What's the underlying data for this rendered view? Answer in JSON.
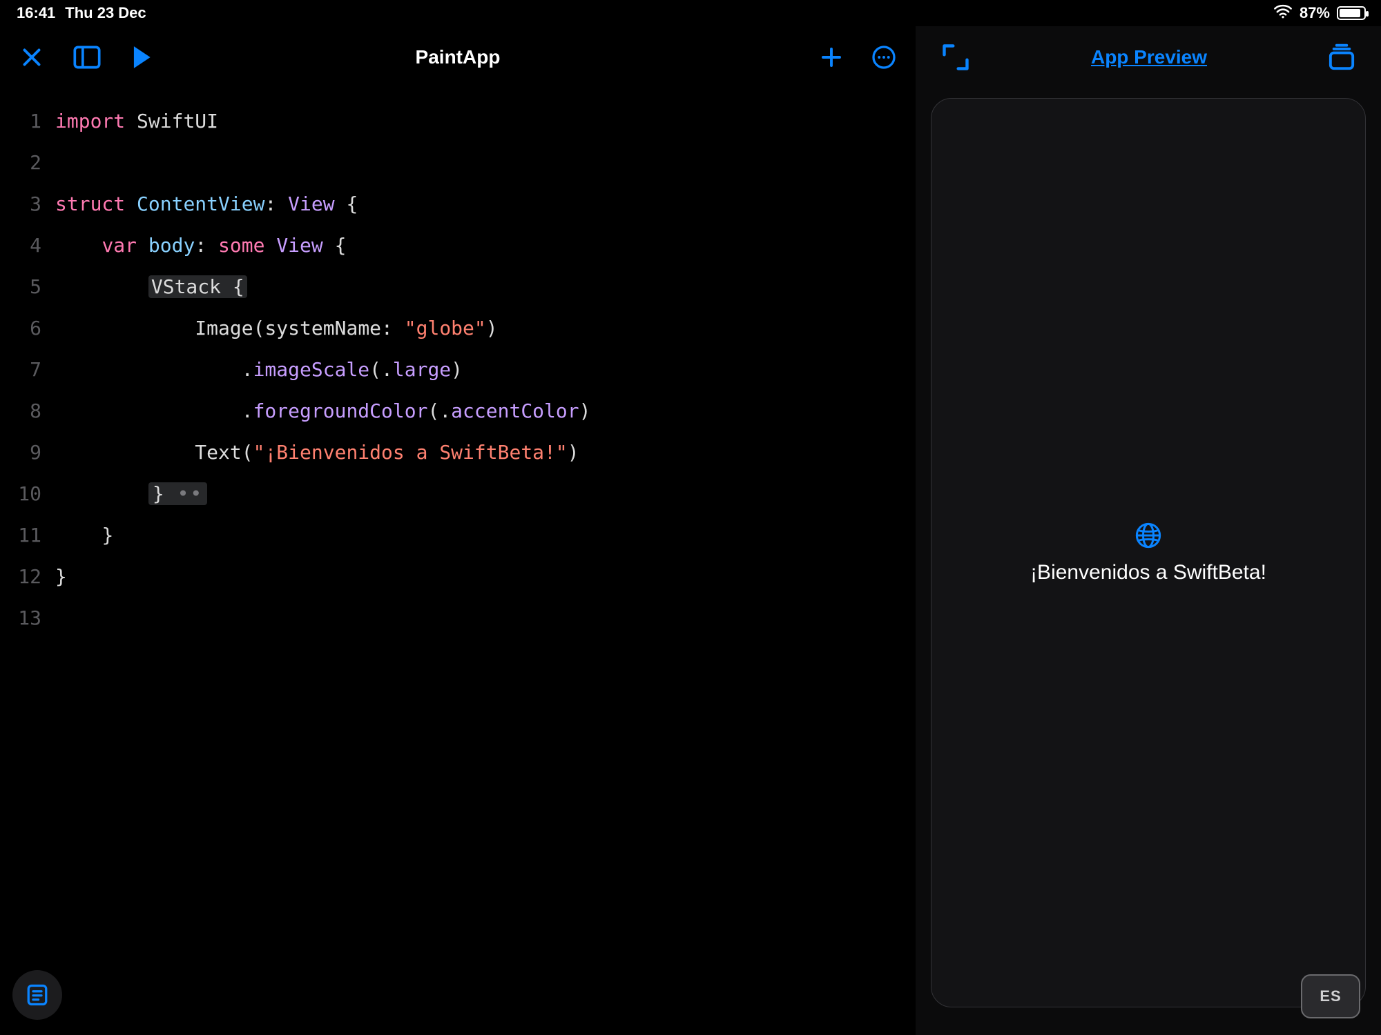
{
  "status": {
    "time": "16:41",
    "date": "Thu 23 Dec",
    "battery_pct": "87%"
  },
  "editor": {
    "title": "PaintApp"
  },
  "preview": {
    "title": "App Preview",
    "text": "¡Bienvenidos a SwiftBeta!"
  },
  "lang": "ES",
  "code": {
    "max_line": 13,
    "l1_import": "import",
    "l1_module": " SwiftUI",
    "l3_struct": "struct",
    "l3_name": " ContentView",
    "l3_colon": ": ",
    "l3_view": "View",
    "l3_brace": " {",
    "l4_indent": "    ",
    "l4_var": "var",
    "l4_body": " body",
    "l4_colon": ": ",
    "l4_some": "some",
    "l4_view": " View",
    "l4_brace": " {",
    "l5_indent": "        ",
    "l5_vstack": "VStack",
    "l5_brace": " {",
    "l6_indent": "            ",
    "l6_image": "Image",
    "l6_open": "(",
    "l6_param": "systemName",
    "l6_colon": ": ",
    "l6_str": "\"globe\"",
    "l6_close": ")",
    "l7_indent": "                ",
    "l7_dot": ".",
    "l7_mod": "imageScale",
    "l7_open": "(",
    "l7_dot2": ".",
    "l7_arg": "large",
    "l7_close": ")",
    "l8_indent": "                ",
    "l8_dot": ".",
    "l8_mod": "foregroundColor",
    "l8_open": "(",
    "l8_dot2": ".",
    "l8_arg": "accentColor",
    "l8_close": ")",
    "l9_indent": "            ",
    "l9_text": "Text",
    "l9_open": "(",
    "l9_str": "\"¡Bienvenidos a SwiftBeta!\"",
    "l9_close": ")",
    "l10_indent": "        ",
    "l10_brace": "}",
    "l10_dots": " ••",
    "l11_indent": "    ",
    "l11_brace": "}",
    "l12_brace": "}"
  }
}
